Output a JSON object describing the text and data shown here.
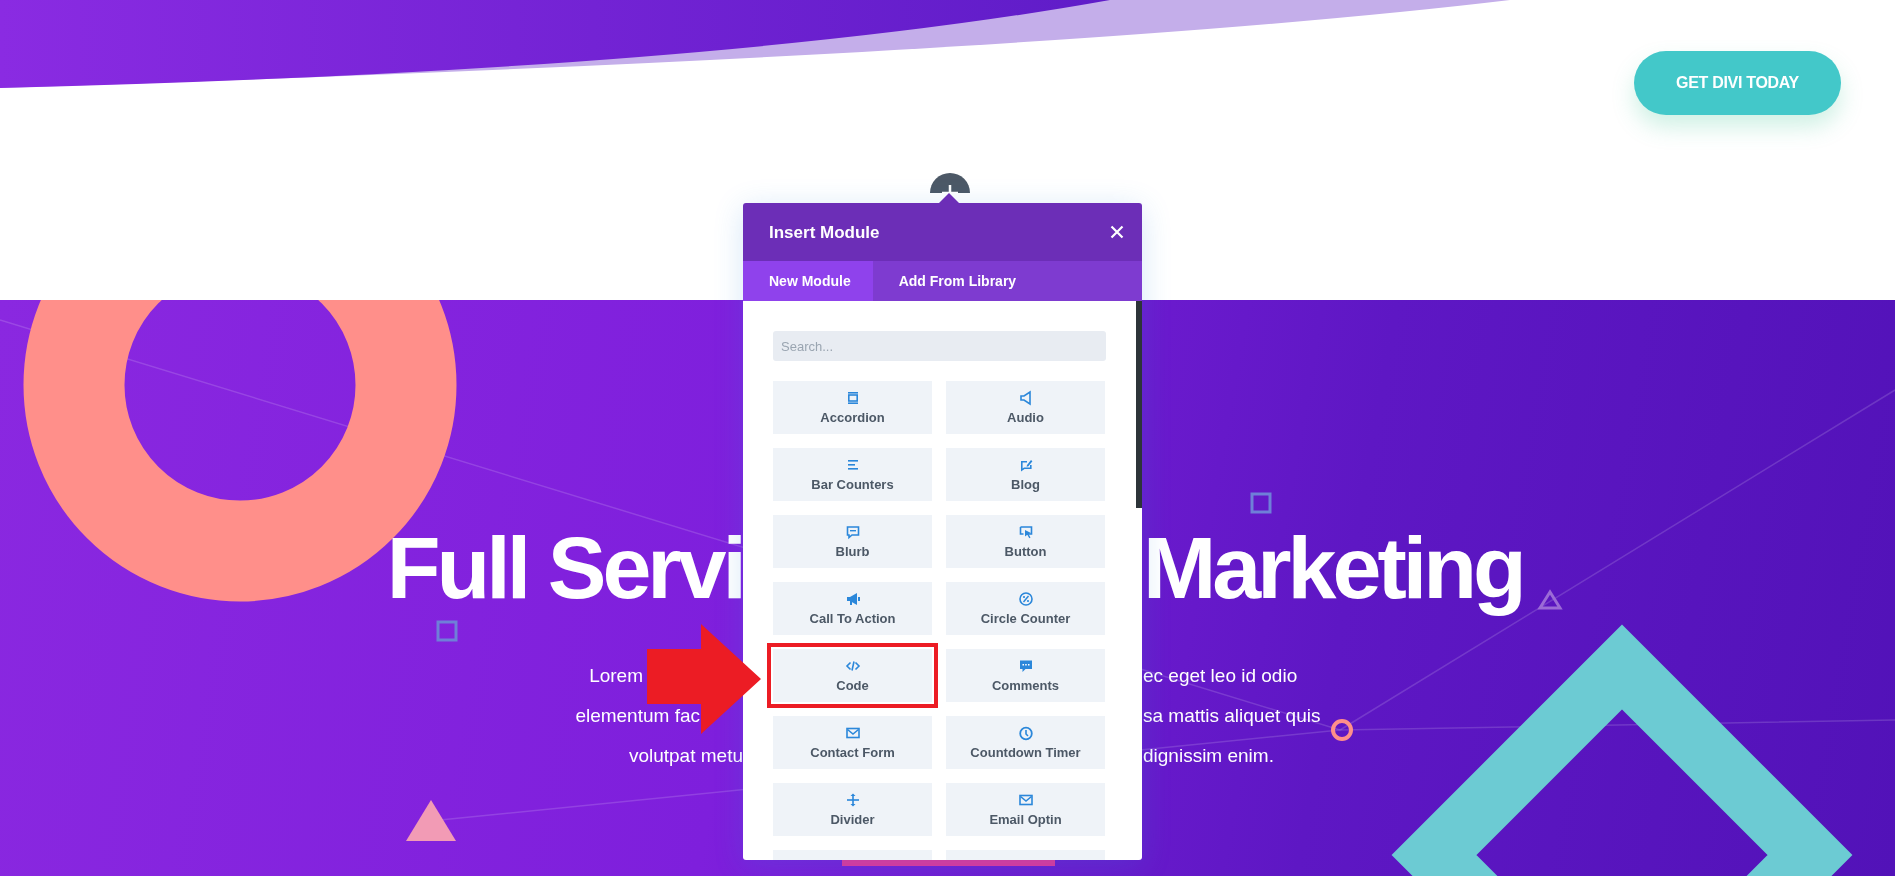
{
  "header": {
    "button": "GET DIVI TODAY"
  },
  "hero": {
    "title_left": "Full Servi",
    "title_right": "Marketing",
    "text_left": [
      "Lorem",
      "elementum fac",
      "volutpat metu"
    ],
    "text_right": [
      "ec eget leo id odio",
      "sa mattis aliquet quis",
      "dignissim enim."
    ]
  },
  "modal": {
    "title": "Insert Module",
    "tabs": [
      {
        "label": "New Module",
        "selected": true
      },
      {
        "label": "Add From Library",
        "selected": false
      }
    ],
    "search": {
      "placeholder": "Search..."
    },
    "modules": [
      {
        "label": "Accordion",
        "highlighted": false
      },
      {
        "label": "Audio",
        "highlighted": false
      },
      {
        "label": "Bar Counters",
        "highlighted": false
      },
      {
        "label": "Blog",
        "highlighted": false
      },
      {
        "label": "Blurb",
        "highlighted": false
      },
      {
        "label": "Button",
        "highlighted": false
      },
      {
        "label": "Call To Action",
        "highlighted": false
      },
      {
        "label": "Circle Counter",
        "highlighted": false
      },
      {
        "label": "Code",
        "highlighted": true
      },
      {
        "label": "Comments",
        "highlighted": false
      },
      {
        "label": "Contact Form",
        "highlighted": false
      },
      {
        "label": "Countdown Timer",
        "highlighted": false
      },
      {
        "label": "Divider",
        "highlighted": false
      },
      {
        "label": "Email Optin",
        "highlighted": false
      }
    ]
  }
}
